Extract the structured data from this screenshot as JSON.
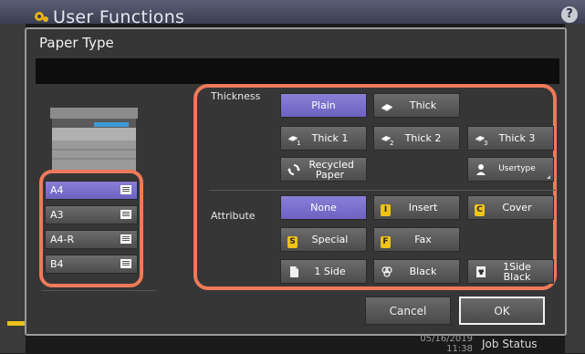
{
  "app": {
    "title": "User Functions",
    "help": "?"
  },
  "status": {
    "date": "05/16/2019",
    "time": "11:38",
    "job_status": "Job Status"
  },
  "dialog": {
    "title": "Paper Type",
    "message": "",
    "paper_sizes": [
      {
        "label": "A4",
        "selected": true
      },
      {
        "label": "A3",
        "selected": false
      },
      {
        "label": "A4-R",
        "selected": false
      },
      {
        "label": "B4",
        "selected": false
      }
    ],
    "thickness": {
      "label": "Thickness",
      "plain": "Plain",
      "thick": "Thick",
      "thick1": "Thick 1",
      "thick1_sub": "1",
      "thick2": "Thick 2",
      "thick2_sub": "2",
      "thick3": "Thick 3",
      "thick3_sub": "3",
      "recycled": "Recycled Paper",
      "usertype": "Usertype"
    },
    "attribute": {
      "label": "Attribute",
      "none": "None",
      "insert": "Insert",
      "insert_badge": "I",
      "cover": "Cover",
      "cover_badge": "C",
      "special": "Special",
      "special_badge": "S",
      "fax": "Fax",
      "fax_badge": "F",
      "one_side": "1 Side",
      "black": "Black",
      "one_side_black": "1Side Black"
    },
    "cancel": "Cancel",
    "ok": "OK"
  },
  "colors": {
    "selected": "#7a6fd0",
    "highlight": "#ee7a5a",
    "button": "#5a5a5a",
    "dialog_bg": "#363636"
  }
}
